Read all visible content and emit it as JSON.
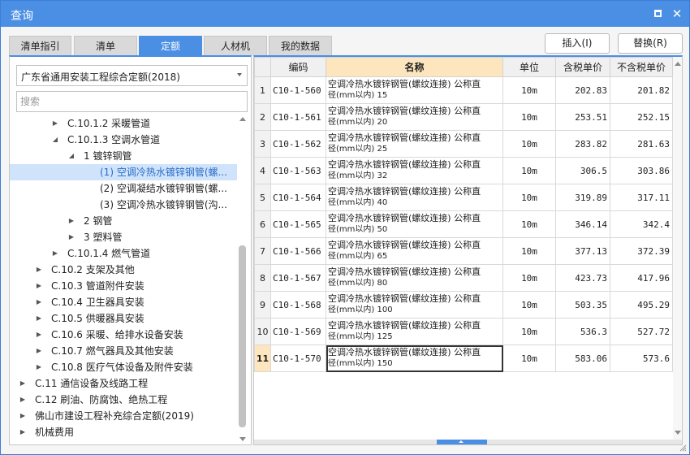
{
  "window": {
    "title": "查询"
  },
  "tabs": [
    {
      "label": "清单指引"
    },
    {
      "label": "清单"
    },
    {
      "label": "定额"
    },
    {
      "label": "人材机"
    },
    {
      "label": "我的数据"
    }
  ],
  "actions": {
    "insert_label": "插入(I)",
    "replace_label": "替换(R)"
  },
  "left": {
    "dropdown_value": "广东省通用安装工程综合定额(2018)",
    "search_placeholder": "搜索",
    "tree": [
      {
        "label": "C.10.1.2 采暖管道",
        "arrow": "▶"
      },
      {
        "label": "C.10.1.3 空调水管道",
        "arrow": "◢"
      },
      {
        "label": "1 镀锌钢管",
        "arrow": "◢"
      },
      {
        "label": "(1) 空调冷热水镀锌钢管(螺...",
        "arrow": ""
      },
      {
        "label": "(2) 空调凝结水镀锌钢管(螺...",
        "arrow": ""
      },
      {
        "label": "(3) 空调冷热水镀锌钢管(沟...",
        "arrow": ""
      },
      {
        "label": "2 钢管",
        "arrow": "▶"
      },
      {
        "label": "3 塑料管",
        "arrow": "▶"
      },
      {
        "label": "C.10.1.4 燃气管道",
        "arrow": "▶"
      },
      {
        "label": "C.10.2 支架及其他",
        "arrow": "▶"
      },
      {
        "label": "C.10.3 管道附件安装",
        "arrow": "▶"
      },
      {
        "label": "C.10.4 卫生器具安装",
        "arrow": "▶"
      },
      {
        "label": "C.10.5 供暖器具安装",
        "arrow": "▶"
      },
      {
        "label": "C.10.6 采暖、给排水设备安装",
        "arrow": "▶"
      },
      {
        "label": "C.10.7 燃气器具及其他安装",
        "arrow": "▶"
      },
      {
        "label": "C.10.8 医疗气体设备及附件安装",
        "arrow": "▶"
      },
      {
        "label": "C.11 通信设备及线路工程",
        "arrow": "▶"
      },
      {
        "label": "C.12 刷油、防腐蚀、绝热工程",
        "arrow": "▶"
      },
      {
        "label": "佛山市建设工程补充综合定额(2019)",
        "arrow": "▶"
      },
      {
        "label": "机械费用",
        "arrow": "▶"
      }
    ]
  },
  "grid": {
    "headers": {
      "code": "编码",
      "name": "名称",
      "unit": "单位",
      "tax_price": "含税单价",
      "notax_price": "不含税单价"
    },
    "rows": [
      {
        "n": "1",
        "code": "C10-1-560",
        "name1": "空调冷热水镀锌钢管(螺纹连接) 公称直",
        "name2": "径(mm以内) 15",
        "unit": "10m",
        "tax": "202.83",
        "notax": "201.82"
      },
      {
        "n": "2",
        "code": "C10-1-561",
        "name1": "空调冷热水镀锌钢管(螺纹连接) 公称直",
        "name2": "径(mm以内) 20",
        "unit": "10m",
        "tax": "253.51",
        "notax": "252.15"
      },
      {
        "n": "3",
        "code": "C10-1-562",
        "name1": "空调冷热水镀锌钢管(螺纹连接) 公称直",
        "name2": "径(mm以内) 25",
        "unit": "10m",
        "tax": "283.82",
        "notax": "281.63"
      },
      {
        "n": "4",
        "code": "C10-1-563",
        "name1": "空调冷热水镀锌钢管(螺纹连接) 公称直",
        "name2": "径(mm以内) 32",
        "unit": "10m",
        "tax": "306.5",
        "notax": "303.86"
      },
      {
        "n": "5",
        "code": "C10-1-564",
        "name1": "空调冷热水镀锌钢管(螺纹连接) 公称直",
        "name2": "径(mm以内) 40",
        "unit": "10m",
        "tax": "319.89",
        "notax": "317.11"
      },
      {
        "n": "6",
        "code": "C10-1-565",
        "name1": "空调冷热水镀锌钢管(螺纹连接) 公称直",
        "name2": "径(mm以内) 50",
        "unit": "10m",
        "tax": "346.14",
        "notax": "342.4"
      },
      {
        "n": "7",
        "code": "C10-1-566",
        "name1": "空调冷热水镀锌钢管(螺纹连接) 公称直",
        "name2": "径(mm以内) 65",
        "unit": "10m",
        "tax": "377.13",
        "notax": "372.39"
      },
      {
        "n": "8",
        "code": "C10-1-567",
        "name1": "空调冷热水镀锌钢管(螺纹连接) 公称直",
        "name2": "径(mm以内) 80",
        "unit": "10m",
        "tax": "423.73",
        "notax": "417.96"
      },
      {
        "n": "9",
        "code": "C10-1-568",
        "name1": "空调冷热水镀锌钢管(螺纹连接) 公称直",
        "name2": "径(mm以内) 100",
        "unit": "10m",
        "tax": "503.35",
        "notax": "495.29"
      },
      {
        "n": "10",
        "code": "C10-1-569",
        "name1": "空调冷热水镀锌钢管(螺纹连接) 公称直",
        "name2": "径(mm以内) 125",
        "unit": "10m",
        "tax": "536.3",
        "notax": "527.72"
      },
      {
        "n": "11",
        "code": "C10-1-570",
        "name1": "空调冷热水镀锌钢管(螺纹连接) 公称直",
        "name2": "径(mm以内) 150",
        "unit": "10m",
        "tax": "583.06",
        "notax": "573.6"
      }
    ]
  },
  "colors": {
    "accent": "#4a8fe4",
    "selected_row_bg": "#fde6bd",
    "tree_selected_bg": "#cfe3fb"
  }
}
